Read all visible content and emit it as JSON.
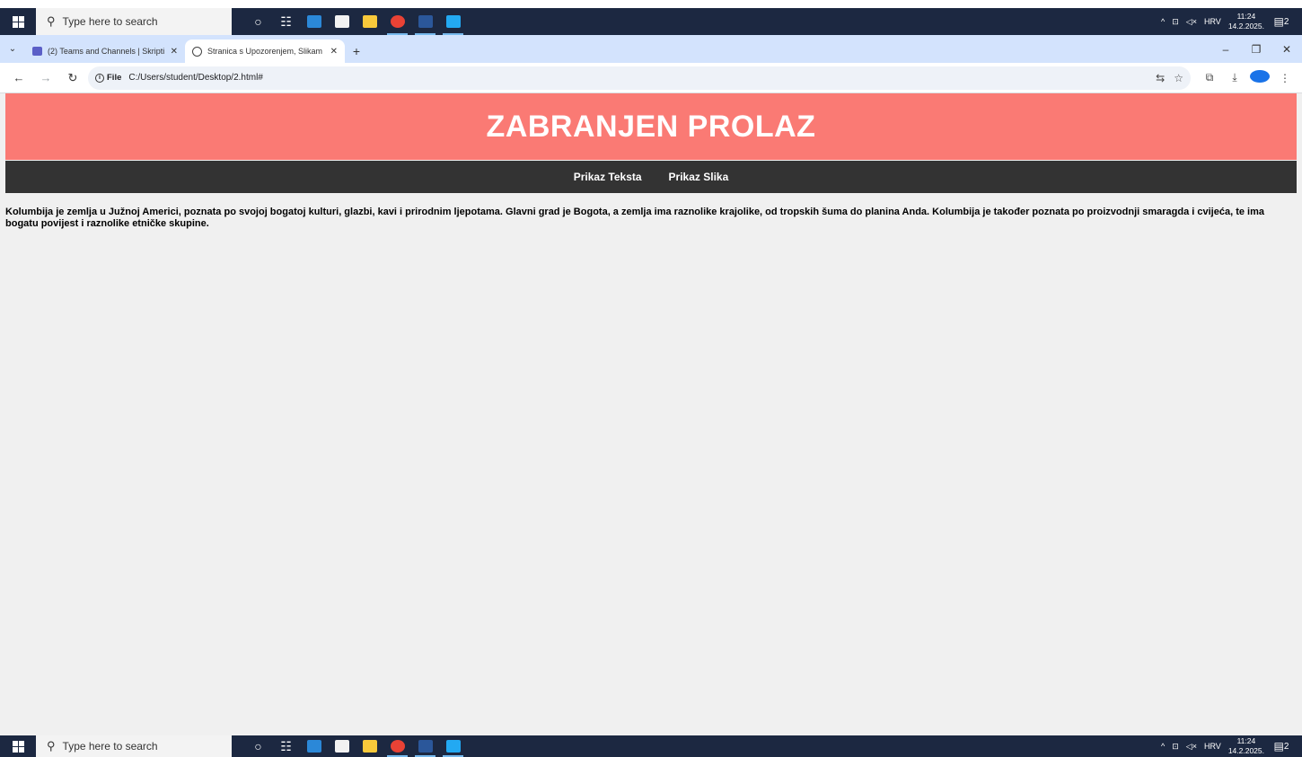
{
  "taskbar": {
    "search_placeholder": "Type here to search",
    "tray": {
      "language": "HRV",
      "time": "11:24",
      "date": "14.2.2025.",
      "notification_count": "2"
    }
  },
  "browser": {
    "tabs": [
      {
        "title": "(2) Teams and Channels | Skripti",
        "icon": "teams-icon",
        "active": false
      },
      {
        "title": "Stranica s Upozorenjem, Slikam",
        "icon": "globe-icon",
        "active": true
      }
    ],
    "address": {
      "chip_label": "File",
      "url": "C:/Users/student/Desktop/2.html#"
    }
  },
  "page": {
    "banner_title": "ZABRANJEN PROLAZ",
    "nav": [
      {
        "label": "Prikaz Teksta"
      },
      {
        "label": "Prikaz Slika"
      }
    ],
    "body_text": "Kolumbija je zemlja u Južnoj Americi, poznata po svojoj bogatoj kulturi, glazbi, kavi i prirodnim ljepotama. Glavni grad je Bogota, a zemlja ima raznolike krajolike, od tropskih šuma do planina Anda. Kolumbija je također poznata po proizvodnji smaragda i cvijeća, te ima bogatu povijest i raznolike etničke skupine."
  },
  "colors": {
    "banner": "#fa7a74",
    "navbar": "#333333",
    "taskbar": "#1c2841",
    "tabbar": "#d3e3fd"
  }
}
